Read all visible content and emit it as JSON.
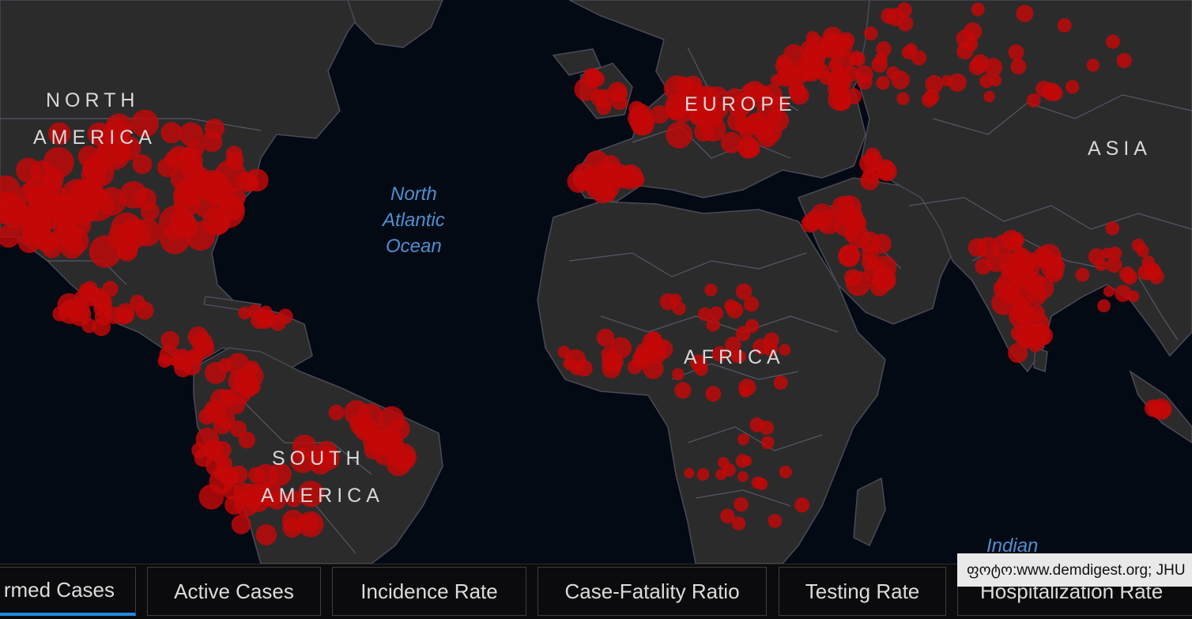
{
  "map": {
    "regions": {
      "north_america": [
        "NORTH",
        "AMERICA"
      ],
      "south_america": [
        "SOUTH",
        "AMERICA"
      ],
      "europe": "EUROPE",
      "africa": "AFRICA",
      "asia": "ASIA"
    },
    "water": {
      "north_atlantic": [
        "North",
        "Atlantic",
        "Ocean"
      ],
      "indian": "Indian"
    },
    "colors": {
      "water": "#040a14",
      "land": "#2b2b2b",
      "borders": "#5c5c70",
      "case_marker": "#c40808",
      "region_label": "#d8d8d8",
      "water_label": "#4f8fd1",
      "active_tab_accent": "#1f8ce0"
    },
    "marker_icon": "case-circle"
  },
  "tabs": [
    {
      "label": "rmed Cases",
      "active": true
    },
    {
      "label": "Active Cases",
      "active": false
    },
    {
      "label": "Incidence Rate",
      "active": false
    },
    {
      "label": "Case-Fatality Ratio",
      "active": false
    },
    {
      "label": "Testing Rate",
      "active": false
    },
    {
      "label": "Hospitalization Rate",
      "active": false
    }
  ],
  "attribution": "ფოტო:www.demdigest.org; JHU"
}
